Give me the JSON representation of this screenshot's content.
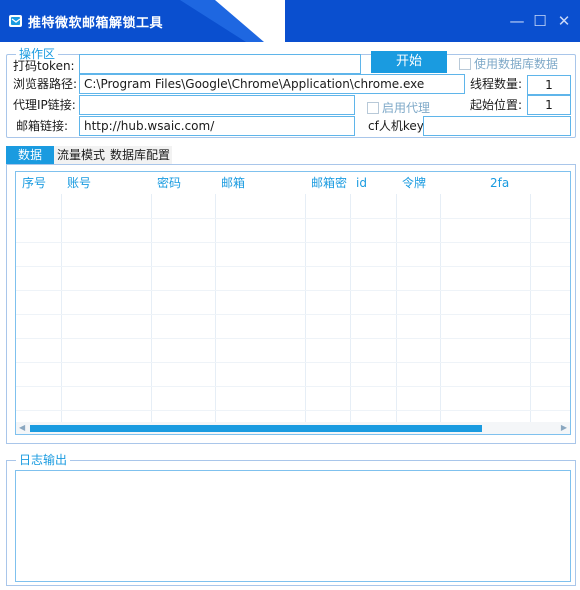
{
  "window": {
    "title": "推特微软邮箱解锁工具",
    "controls": {
      "minimize": "—",
      "maximize": "☐",
      "close": "✕"
    }
  },
  "ops": {
    "legend": "操作区",
    "token_label": "打码token:",
    "token_value": "",
    "start_label": "开始",
    "use_db_label": "使用数据库数据",
    "use_db_checked": false,
    "browser_label": "浏览器路径:",
    "browser_value": "C:\\Program Files\\Google\\Chrome\\Application\\chrome.exe",
    "threads_label": "线程数量:",
    "threads_value": "1",
    "proxy_label": "代理IP链接:",
    "proxy_value": "",
    "enable_proxy_label": "启用代理",
    "enable_proxy_checked": false,
    "start_pos_label": "起始位置:",
    "start_pos_value": "1",
    "mail_link_label": "邮箱链接:",
    "mail_link_value": "http://hub.wsaic.com/",
    "cf_key_label": "cf人机key:",
    "cf_key_value": ""
  },
  "tabs": [
    {
      "label": "数据",
      "active": true
    },
    {
      "label": "流量模式",
      "active": false
    },
    {
      "label": "数据库配置",
      "active": false
    }
  ],
  "grid": {
    "columns": [
      "序号",
      "账号",
      "密码",
      "邮箱",
      "邮箱密",
      "id",
      "令牌",
      "2fa"
    ],
    "rows": []
  },
  "log": {
    "legend": "日志输出",
    "content": ""
  },
  "colors": {
    "titlebar": "#0a4fcf",
    "accent": "#1a9be0",
    "border": "#5fb5ea"
  }
}
